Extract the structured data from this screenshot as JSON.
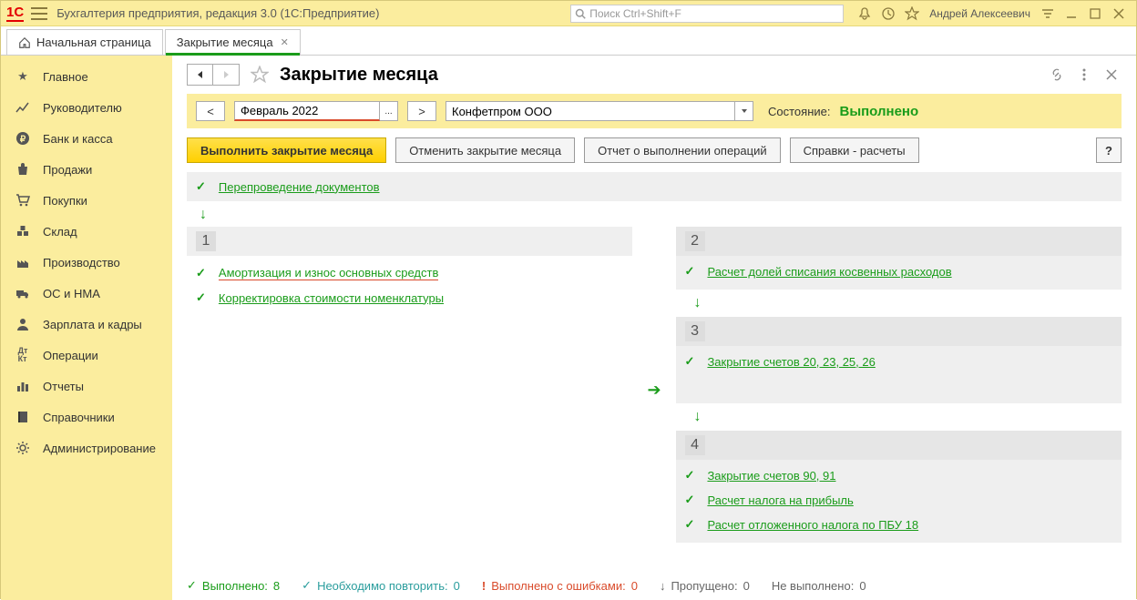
{
  "titlebar": {
    "app_title": "Бухгалтерия предприятия, редакция 3.0  (1С:Предприятие)",
    "search_placeholder": "Поиск Ctrl+Shift+F",
    "user": "Андрей Алексеевич"
  },
  "tabs": {
    "home": "Начальная страница",
    "active": "Закрытие месяца"
  },
  "sidebar": {
    "items": [
      "Главное",
      "Руководителю",
      "Банк и касса",
      "Продажи",
      "Покупки",
      "Склад",
      "Производство",
      "ОС и НМА",
      "Зарплата и кадры",
      "Операции",
      "Отчеты",
      "Справочники",
      "Администрирование"
    ]
  },
  "page": {
    "title": "Закрытие месяца",
    "period": "Февраль 2022",
    "org": "Конфетпром ООО",
    "state_label": "Состояние:",
    "state_value": "Выполнено"
  },
  "actions": {
    "run": "Выполнить закрытие месяца",
    "cancel": "Отменить закрытие месяца",
    "report": "Отчет о выполнении операций",
    "refs": "Справки - расчеты",
    "help": "?"
  },
  "ops": {
    "repost": "Перепроведение документов",
    "stage1_ops": [
      "Амортизация и износ основных средств",
      "Корректировка стоимости номенклатуры"
    ],
    "stage2_op": "Расчет долей списания косвенных расходов",
    "stage3_op": "Закрытие счетов 20, 23, 25, 26",
    "stage4_ops": [
      "Закрытие счетов 90, 91",
      "Расчет налога на прибыль",
      "Расчет отложенного налога по ПБУ 18"
    ],
    "nums": {
      "s1": "1",
      "s2": "2",
      "s3": "3",
      "s4": "4"
    }
  },
  "status": {
    "done_label": "Выполнено:",
    "done_n": "8",
    "repeat_label": "Необходимо повторить:",
    "repeat_n": "0",
    "err_label": "Выполнено с ошибками:",
    "err_n": "0",
    "skip_label": "Пропущено:",
    "skip_n": "0",
    "not_label": "Не выполнено:",
    "not_n": "0"
  }
}
